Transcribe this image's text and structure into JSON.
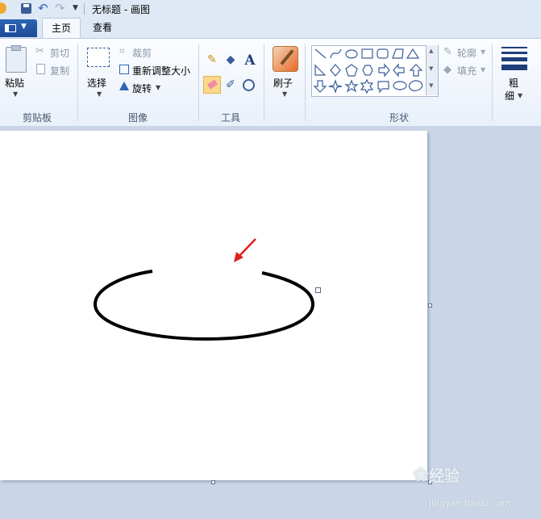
{
  "window": {
    "title": "无标题 - 画图"
  },
  "tabs": [
    {
      "label": "主页"
    },
    {
      "label": "查看"
    }
  ],
  "clipboard": {
    "paste": "粘贴",
    "cut": "剪切",
    "copy": "复制",
    "group": "剪贴板"
  },
  "image": {
    "select": "选择",
    "crop": "裁剪",
    "resize": "重新调整大小",
    "rotate": "旋转",
    "group": "图像"
  },
  "tools": {
    "group": "工具"
  },
  "brushes": {
    "label": "刷子"
  },
  "shapes": {
    "outline": "轮廓",
    "fill": "填充",
    "group": "形状"
  },
  "size": {
    "label_line1": "粗",
    "label_line2": "细"
  },
  "watermark": {
    "brand": "经验",
    "url": "jingyan.baidu.com"
  },
  "colors": {
    "accent": "#1b4a97",
    "arrow": "#e02020",
    "ellipse": "#000000"
  }
}
